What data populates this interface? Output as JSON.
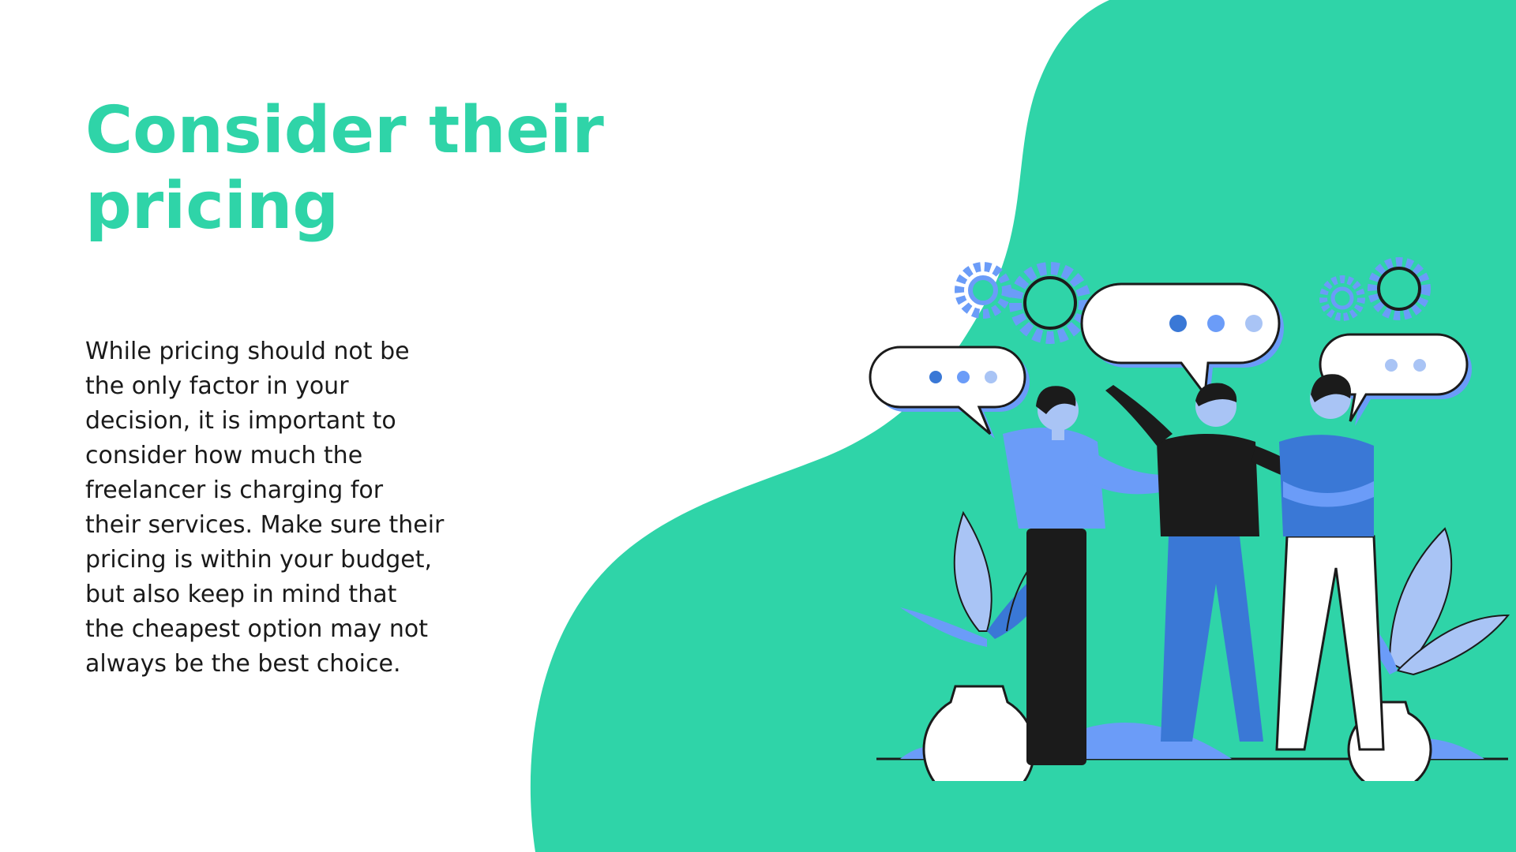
{
  "slide": {
    "title": "Consider their\npricing",
    "body": "While pricing should not be\nthe only factor in your\ndecision, it is important to\nconsider how much the\nfreelancer is charging for\ntheir services. Make sure their\npricing is within your budget,\nbut also keep in mind that\nthe cheapest option may not\nalways be the best choice."
  },
  "colors": {
    "accent": "#2fd4a8",
    "illustration_blue": "#6b9cf8",
    "illustration_dark_blue": "#3a78d6",
    "illustration_black": "#1b1b1b",
    "text": "#1a1a1a",
    "background": "#ffffff"
  },
  "illustration": {
    "subject": "three-people-talking-with-speech-bubbles-illustration",
    "icons": [
      "gear-icon",
      "speech-bubble-icon",
      "plant-icon"
    ]
  }
}
